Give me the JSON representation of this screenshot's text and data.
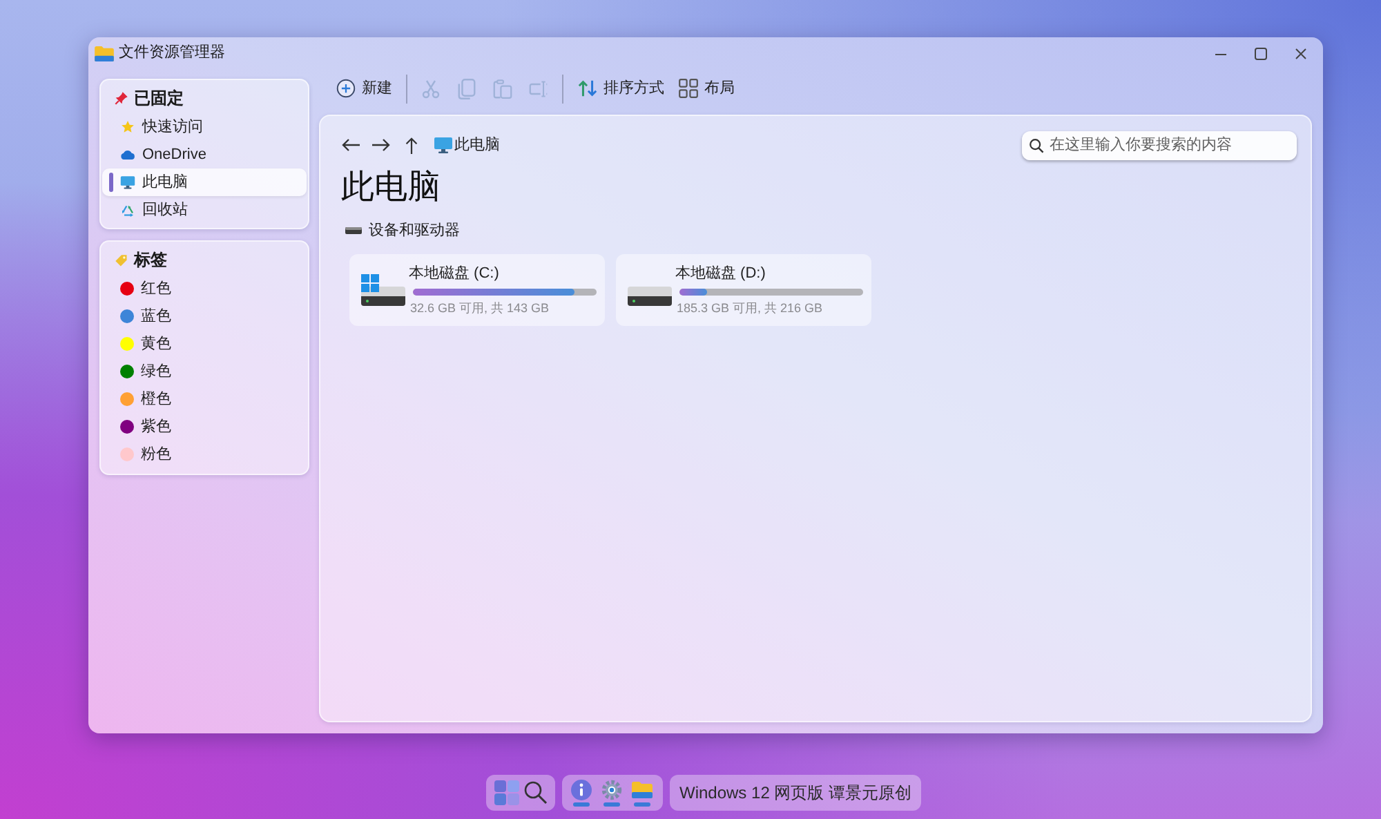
{
  "window": {
    "title": "文件资源管理器"
  },
  "sidebar": [
    {
      "title": "已固定",
      "items": [
        {
          "label": "快速访问",
          "selected": false
        },
        {
          "label": "OneDrive",
          "selected": false
        },
        {
          "label": "此电脑",
          "selected": true
        },
        {
          "label": "回收站",
          "selected": false
        }
      ]
    },
    {
      "title": "标签",
      "items": [
        {
          "label": "红色",
          "color": "#e60012",
          "selected": false
        },
        {
          "label": "蓝色",
          "color": "#3d85d8",
          "selected": false
        },
        {
          "label": "黄色",
          "color": "#ffff00",
          "selected": false
        },
        {
          "label": "绿色",
          "color": "#008000",
          "selected": false
        },
        {
          "label": "橙色",
          "color": "#ffa033",
          "selected": false
        },
        {
          "label": "紫色",
          "color": "#800080",
          "selected": false
        },
        {
          "label": "粉色",
          "color": "#ffc8cc",
          "selected": false
        }
      ]
    }
  ],
  "toolbar": [
    [
      {
        "label": "新建",
        "disabled": false
      }
    ],
    [
      {
        "disabled": true
      },
      {
        "disabled": true
      },
      {
        "disabled": true
      },
      {
        "disabled": true
      }
    ],
    [
      {
        "label": "排序方式",
        "disabled": false
      },
      {
        "label": "布局",
        "disabled": false
      }
    ]
  ],
  "address_bar": {
    "location": "此电脑"
  },
  "search": {
    "placeholder": "在这里输入你要搜索的内容"
  },
  "page_title": "此电脑",
  "devices": {
    "title": "设备和驱动器",
    "drives": [
      {
        "name": "本地磁盘 (C:)",
        "system_drive": true,
        "level": 0.88,
        "caption": "32.6 GB 可用, 共 143 GB"
      },
      {
        "name": "本地磁盘 (D:)",
        "system_drive": false,
        "level": 0.15,
        "caption": "185.3 GB 可用, 共 216 GB"
      }
    ]
  },
  "taskbar": {
    "apps": [
      {
        "open": true
      },
      {
        "open": true
      },
      {
        "open": true
      }
    ],
    "label": "Windows 12 网页版 谭景元原创"
  }
}
